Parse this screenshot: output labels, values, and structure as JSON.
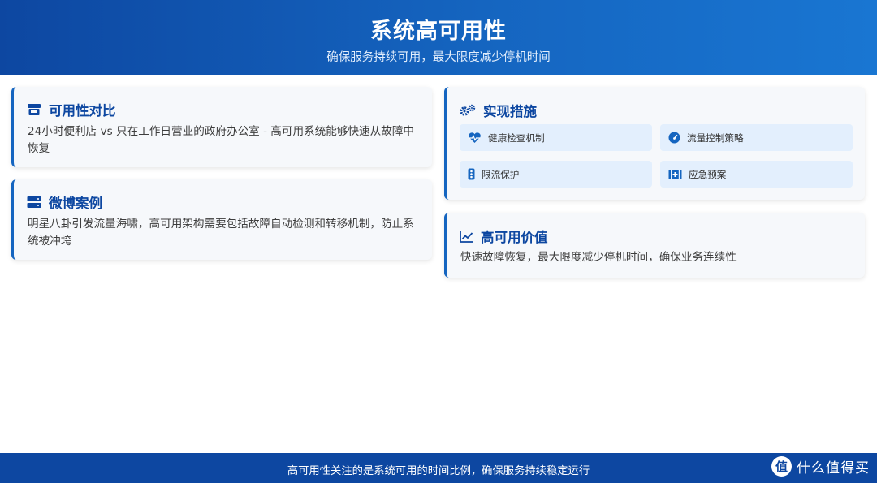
{
  "header": {
    "title": "系统高可用性",
    "subtitle": "确保服务持续可用，最大限度减少停机时间"
  },
  "cards": {
    "comparison": {
      "title": "可用性对比",
      "icon": "store-icon",
      "text": "24小时便利店 vs 只在工作日营业的政府办公室 - 高可用系统能够快速从故障中恢复"
    },
    "weibo": {
      "title": "微博案例",
      "icon": "server-icon",
      "text": "明星八卦引发流量海啸，高可用架构需要包括故障自动检测和转移机制，防止系统被冲垮"
    },
    "measures": {
      "title": "实现措施",
      "icon": "gears-icon",
      "items": [
        {
          "label": "健康检查机制",
          "icon": "heartbeat-icon"
        },
        {
          "label": "流量控制策略",
          "icon": "gauge-icon"
        },
        {
          "label": "限流保护",
          "icon": "traffic-light-icon"
        },
        {
          "label": "应急预案",
          "icon": "first-aid-kit-icon"
        }
      ]
    },
    "value": {
      "title": "高可用价值",
      "icon": "line-chart-icon",
      "text": "快速故障恢复，最大限度减少停机时间，确保业务连续性"
    }
  },
  "footer": {
    "text": "高可用性关注的是系统可用的时间比例，确保服务持续稳定运行",
    "brand_logo": "值",
    "brand_name": "什么值得买"
  },
  "colors": {
    "primary": "#0d47a1",
    "accent": "#1565c0",
    "card_bg": "#f6f8fb",
    "chip_bg": "#e3effd"
  }
}
